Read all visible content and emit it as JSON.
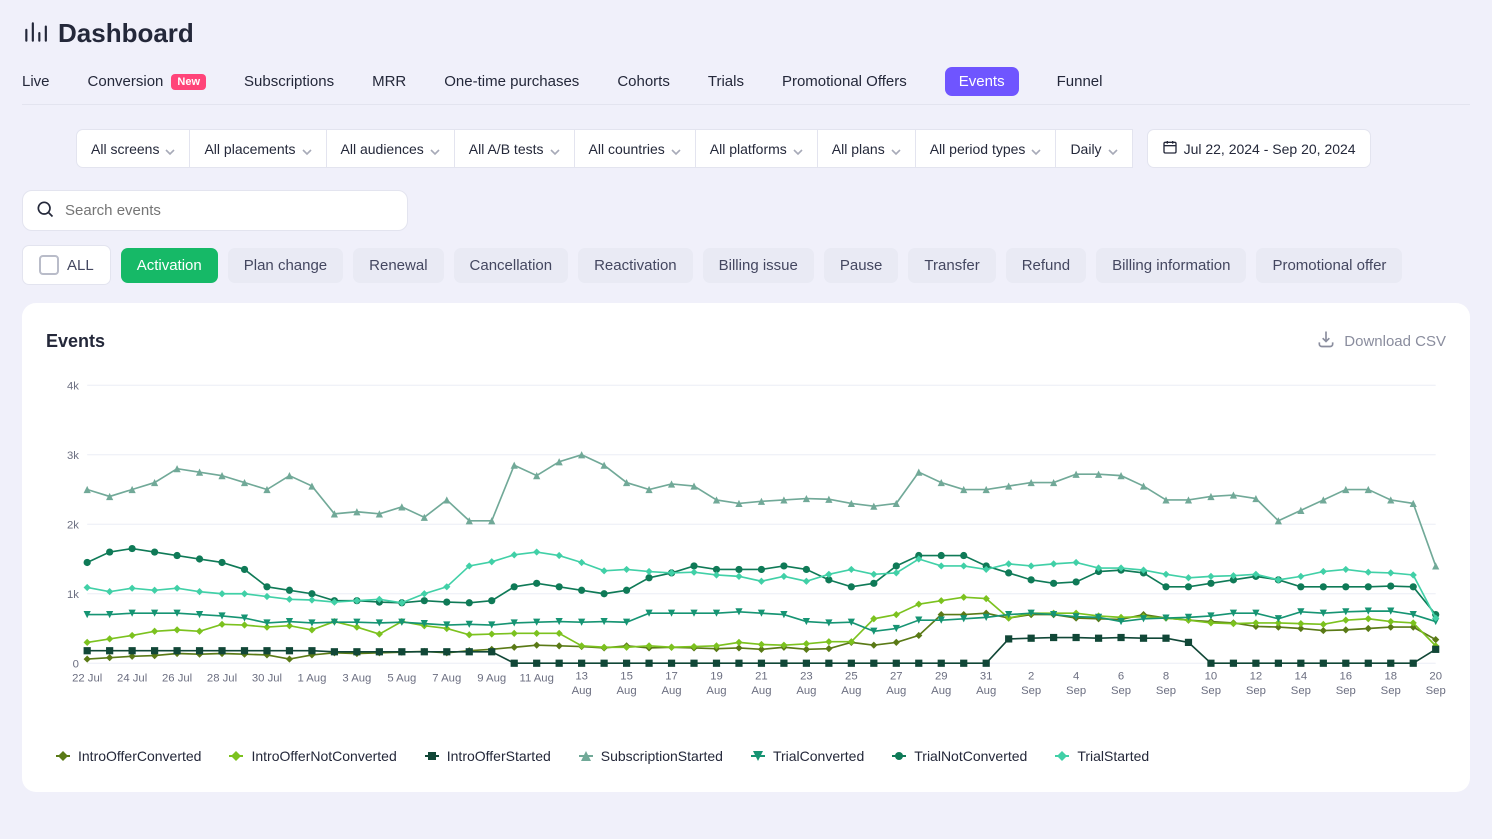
{
  "header": {
    "title": "Dashboard"
  },
  "tabs": [
    {
      "label": "Live"
    },
    {
      "label": "Conversion",
      "badge": "New"
    },
    {
      "label": "Subscriptions"
    },
    {
      "label": "MRR"
    },
    {
      "label": "One-time purchases"
    },
    {
      "label": "Cohorts"
    },
    {
      "label": "Trials"
    },
    {
      "label": "Promotional Offers"
    },
    {
      "label": "Events",
      "active": true
    },
    {
      "label": "Funnel"
    }
  ],
  "filters": [
    {
      "label": "All screens"
    },
    {
      "label": "All placements"
    },
    {
      "label": "All audiences"
    },
    {
      "label": "All A/B tests"
    },
    {
      "label": "All countries"
    },
    {
      "label": "All platforms"
    },
    {
      "label": "All plans"
    },
    {
      "label": "All period types"
    },
    {
      "label": "Daily"
    }
  ],
  "date_range": "Jul 22, 2024 - Sep 20, 2024",
  "search": {
    "placeholder": "Search events",
    "value": ""
  },
  "chips": [
    {
      "label": "ALL",
      "kind": "all"
    },
    {
      "label": "Activation",
      "kind": "active"
    },
    {
      "label": "Plan change"
    },
    {
      "label": "Renewal"
    },
    {
      "label": "Cancellation"
    },
    {
      "label": "Reactivation"
    },
    {
      "label": "Billing issue"
    },
    {
      "label": "Pause"
    },
    {
      "label": "Transfer"
    },
    {
      "label": "Refund"
    },
    {
      "label": "Billing information"
    },
    {
      "label": "Promotional offer"
    }
  ],
  "panel": {
    "title": "Events",
    "download": "Download CSV"
  },
  "chart_data": {
    "type": "line",
    "title": "Events",
    "xlabel": "",
    "ylabel": "",
    "ylim": [
      0,
      4000
    ],
    "y_ticks": [
      0,
      "1k",
      "2k",
      "3k",
      "4k"
    ],
    "categories": [
      "22 Jul",
      "23 Jul",
      "24 Jul",
      "25 Jul",
      "26 Jul",
      "27 Jul",
      "28 Jul",
      "29 Jul",
      "30 Jul",
      "31 Jul",
      "1 Aug",
      "2 Aug",
      "3 Aug",
      "4 Aug",
      "5 Aug",
      "6 Aug",
      "7 Aug",
      "8 Aug",
      "9 Aug",
      "10 Aug",
      "11 Aug",
      "12 Aug",
      "13 Aug",
      "14 Aug",
      "15 Aug",
      "16 Aug",
      "17 Aug",
      "18 Aug",
      "19 Aug",
      "20 Aug",
      "21 Aug",
      "22 Aug",
      "23 Aug",
      "24 Aug",
      "25 Aug",
      "26 Aug",
      "27 Aug",
      "28 Aug",
      "29 Aug",
      "30 Aug",
      "31 Aug",
      "1 Sep",
      "2 Sep",
      "3 Sep",
      "4 Sep",
      "5 Sep",
      "6 Sep",
      "7 Sep",
      "8 Sep",
      "9 Sep",
      "10 Sep",
      "11 Sep",
      "12 Sep",
      "13 Sep",
      "14 Sep",
      "15 Sep",
      "16 Sep",
      "17 Sep",
      "18 Sep",
      "19 Sep",
      "20 Sep"
    ],
    "x_tick_labels": [
      "22 Jul",
      "",
      "24 Jul",
      "",
      "26 Jul",
      "",
      "28 Jul",
      "",
      "30 Jul",
      "",
      "1 Aug",
      "",
      "3 Aug",
      "",
      "5 Aug",
      "",
      "7 Aug",
      "",
      "9 Aug",
      "",
      "11 Aug",
      "",
      "13 Aug",
      "",
      "15 Aug",
      "",
      "17 Aug",
      "",
      "19 Aug",
      "",
      "21 Aug",
      "",
      "23 Aug",
      "",
      "25 Aug",
      "",
      "27 Aug",
      "",
      "29 Aug",
      "",
      "31 Aug",
      "",
      "2 Sep",
      "",
      "4 Sep",
      "",
      "6 Sep",
      "",
      "8 Sep",
      "",
      "10 Sep",
      "",
      "12 Sep",
      "",
      "14 Sep",
      "",
      "16 Sep",
      "",
      "18 Sep",
      "",
      "20 Sep"
    ],
    "series": [
      {
        "name": "IntroOfferConverted",
        "color": "#5a7a16",
        "marker": "diamond",
        "values": [
          60,
          80,
          100,
          110,
          140,
          130,
          140,
          130,
          120,
          60,
          120,
          150,
          140,
          150,
          160,
          170,
          150,
          180,
          200,
          230,
          260,
          250,
          240,
          220,
          250,
          220,
          230,
          220,
          210,
          220,
          200,
          230,
          200,
          210,
          300,
          260,
          300,
          400,
          700,
          700,
          720,
          650,
          700,
          700,
          650,
          640,
          630,
          700,
          650,
          620,
          600,
          580,
          530,
          520,
          500,
          470,
          480,
          500,
          520,
          520,
          340
        ]
      },
      {
        "name": "IntroOfferNotConverted",
        "color": "#7cc21f",
        "marker": "diamond",
        "values": [
          300,
          350,
          400,
          460,
          480,
          460,
          560,
          550,
          520,
          540,
          480,
          600,
          520,
          420,
          600,
          540,
          500,
          410,
          420,
          430,
          430,
          430,
          250,
          230,
          230,
          250,
          230,
          240,
          250,
          300,
          270,
          260,
          280,
          310,
          310,
          640,
          700,
          850,
          900,
          950,
          930,
          650,
          720,
          720,
          720,
          680,
          660,
          670,
          650,
          620,
          580,
          570,
          580,
          580,
          570,
          560,
          620,
          640,
          600,
          580,
          250
        ]
      },
      {
        "name": "IntroOfferStarted",
        "color": "#114737",
        "marker": "square",
        "values": [
          180,
          180,
          180,
          180,
          180,
          180,
          180,
          180,
          180,
          180,
          180,
          165,
          165,
          165,
          165,
          165,
          165,
          165,
          165,
          0,
          0,
          0,
          0,
          0,
          0,
          0,
          0,
          0,
          0,
          0,
          0,
          0,
          0,
          0,
          0,
          0,
          0,
          0,
          0,
          0,
          0,
          350,
          360,
          370,
          370,
          360,
          370,
          360,
          360,
          300,
          0,
          0,
          0,
          0,
          0,
          0,
          0,
          0,
          0,
          0,
          200
        ]
      },
      {
        "name": "SubscriptionStarted",
        "color": "#71a998",
        "marker": "triangle",
        "values": [
          2500,
          2400,
          2500,
          2600,
          2800,
          2750,
          2700,
          2600,
          2500,
          2700,
          2550,
          2150,
          2180,
          2150,
          2250,
          2100,
          2350,
          2050,
          2050,
          2850,
          2700,
          2900,
          3000,
          2850,
          2600,
          2500,
          2580,
          2550,
          2350,
          2300,
          2330,
          2350,
          2370,
          2360,
          2300,
          2260,
          2300,
          2750,
          2600,
          2500,
          2500,
          2550,
          2600,
          2600,
          2720,
          2720,
          2700,
          2550,
          2350,
          2350,
          2400,
          2420,
          2370,
          2050,
          2200,
          2350,
          2500,
          2500,
          2350,
          2300,
          1400
        ]
      },
      {
        "name": "TrialConverted",
        "color": "#169473",
        "marker": "tri-down",
        "values": [
          700,
          700,
          720,
          720,
          720,
          700,
          680,
          650,
          580,
          600,
          580,
          590,
          590,
          580,
          590,
          570,
          550,
          560,
          550,
          580,
          590,
          600,
          590,
          600,
          590,
          720,
          720,
          720,
          720,
          740,
          720,
          700,
          600,
          580,
          590,
          460,
          500,
          620,
          620,
          640,
          660,
          700,
          720,
          700,
          670,
          660,
          600,
          640,
          650,
          660,
          680,
          720,
          720,
          640,
          740,
          720,
          740,
          750,
          750,
          700,
          600
        ]
      },
      {
        "name": "TrialNotConverted",
        "color": "#0f7a57",
        "marker": "circle",
        "values": [
          1450,
          1600,
          1650,
          1600,
          1550,
          1500,
          1450,
          1350,
          1100,
          1050,
          1000,
          900,
          900,
          880,
          870,
          900,
          880,
          870,
          900,
          1100,
          1150,
          1100,
          1050,
          1000,
          1050,
          1230,
          1300,
          1400,
          1350,
          1350,
          1350,
          1400,
          1350,
          1200,
          1100,
          1150,
          1400,
          1550,
          1550,
          1550,
          1400,
          1300,
          1200,
          1150,
          1170,
          1320,
          1340,
          1300,
          1100,
          1100,
          1150,
          1200,
          1250,
          1200,
          1100,
          1100,
          1100,
          1100,
          1110,
          1100,
          700
        ]
      },
      {
        "name": "TrialStarted",
        "color": "#41d0a7",
        "marker": "diamond",
        "values": [
          1090,
          1030,
          1080,
          1050,
          1080,
          1030,
          1000,
          1000,
          960,
          920,
          910,
          880,
          900,
          920,
          870,
          1000,
          1100,
          1400,
          1460,
          1560,
          1600,
          1550,
          1450,
          1330,
          1350,
          1320,
          1300,
          1310,
          1270,
          1250,
          1180,
          1250,
          1180,
          1280,
          1350,
          1280,
          1300,
          1500,
          1400,
          1400,
          1350,
          1430,
          1400,
          1430,
          1450,
          1370,
          1370,
          1340,
          1280,
          1230,
          1250,
          1260,
          1280,
          1200,
          1250,
          1320,
          1350,
          1310,
          1300,
          1270,
          650
        ]
      }
    ],
    "legend_position": "bottom"
  }
}
